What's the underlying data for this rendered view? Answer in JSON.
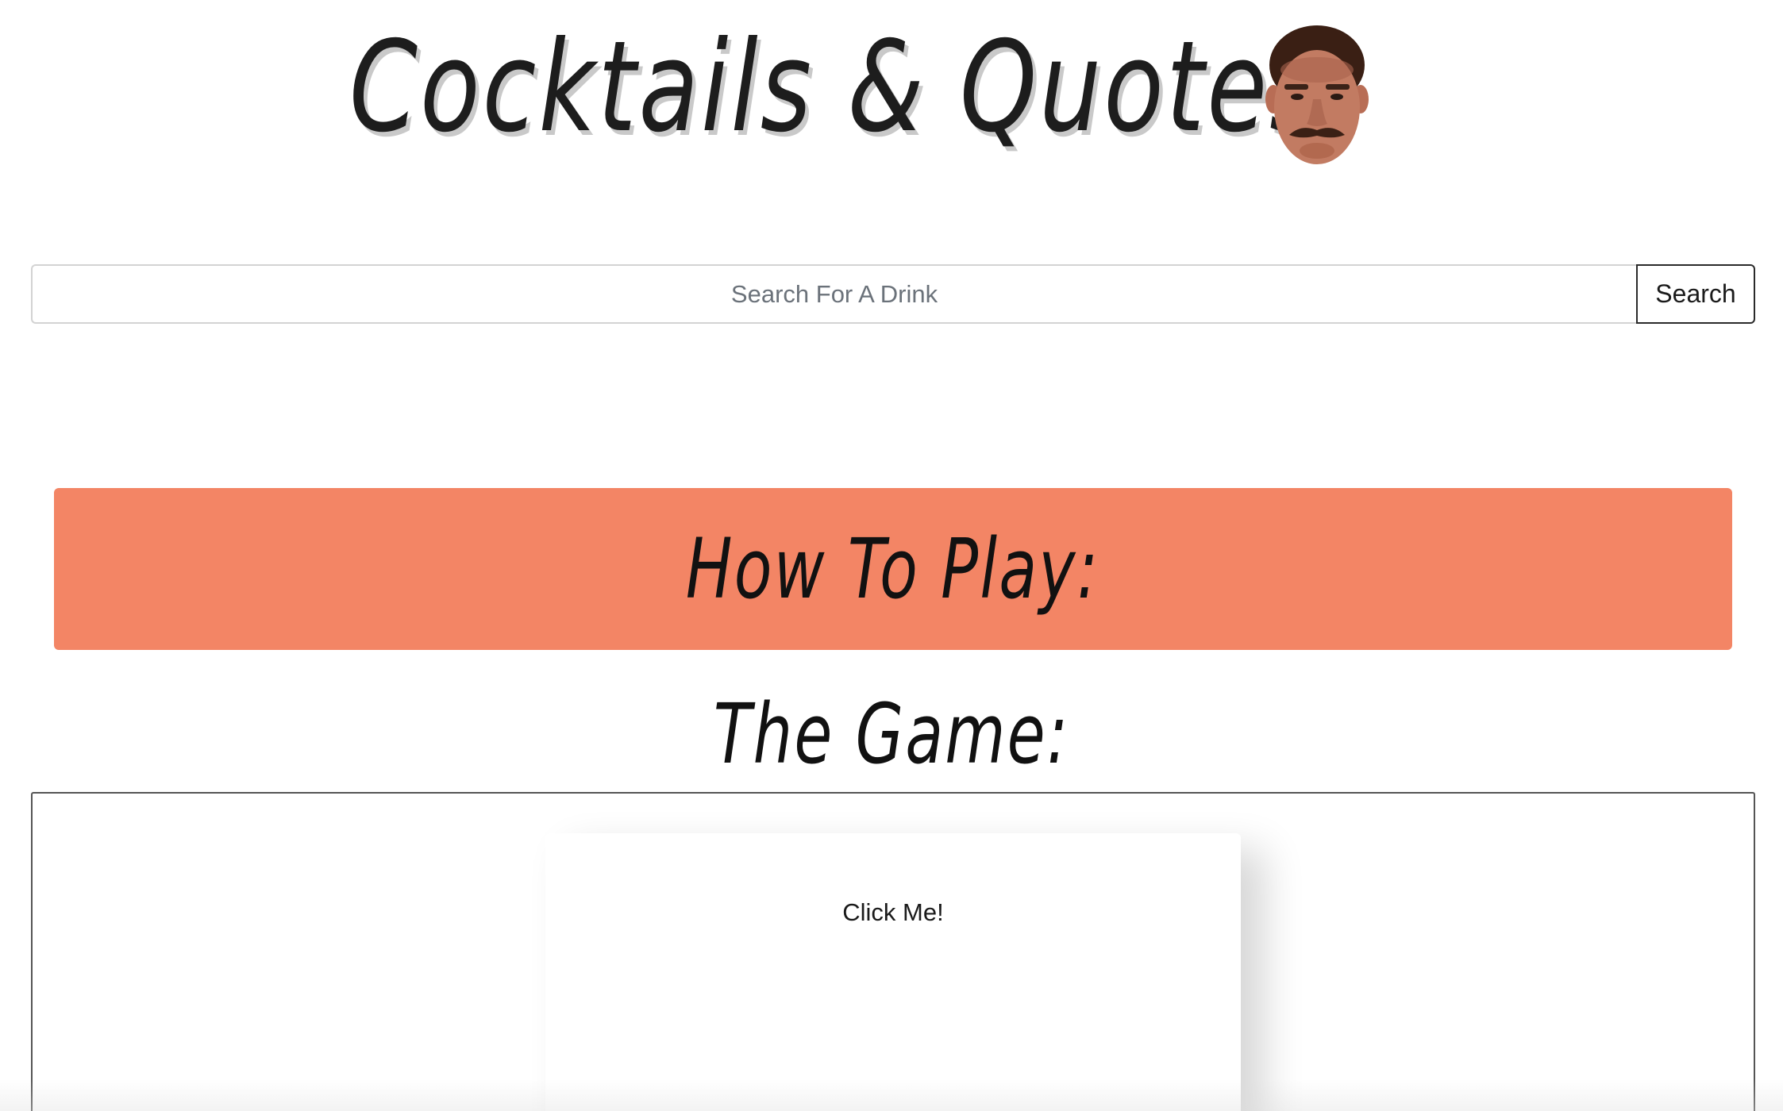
{
  "header": {
    "title": "Cocktails & Quotes",
    "avatar_icon": "ron-swanson-face-icon"
  },
  "search": {
    "placeholder": "Search For A Drink",
    "value": "",
    "button_label": "Search"
  },
  "how_to_play": {
    "title": "How To Play:",
    "color": "#f38565"
  },
  "game": {
    "heading": "The Game:",
    "card_label": "Click Me!"
  }
}
